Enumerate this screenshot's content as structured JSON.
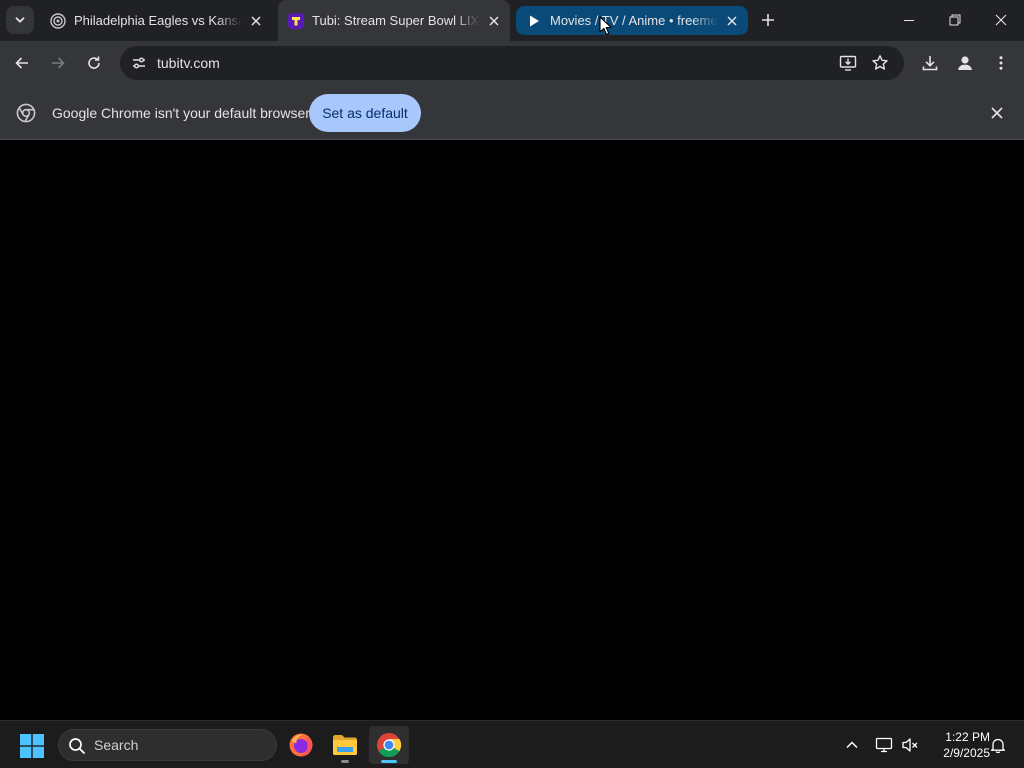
{
  "browser": {
    "tabs": [
      {
        "title": "Philadelphia Eagles vs Kansas City",
        "favicon": "target-icon",
        "state": "inactive"
      },
      {
        "title": "Tubi: Stream Super Bowl LIX for Free",
        "favicon": "tubi-icon",
        "state": "active"
      },
      {
        "title": "Movies / TV / Anime • freemediaheckyeah",
        "favicon": "play-icon",
        "state": "hovered"
      }
    ],
    "address_bar": {
      "url": "tubitv.com"
    },
    "infobar": {
      "message": "Google Chrome isn't your default browser",
      "button_label": "Set as default"
    }
  },
  "taskbar": {
    "search_placeholder": "Search",
    "pinned_apps": [
      "firefox-icon",
      "file-explorer-icon",
      "chrome-icon"
    ],
    "clock": {
      "time": "1:22 PM",
      "date": "2/9/2025"
    }
  },
  "colors": {
    "tabstrip_bg": "#202124",
    "toolbar_bg": "#35363a",
    "hover_tab_bg": "#0a4a78",
    "set_default_button": "#a8c7fa",
    "taskbar_bg": "#1c1c1c",
    "active_indicator": "#4cc2ff"
  }
}
